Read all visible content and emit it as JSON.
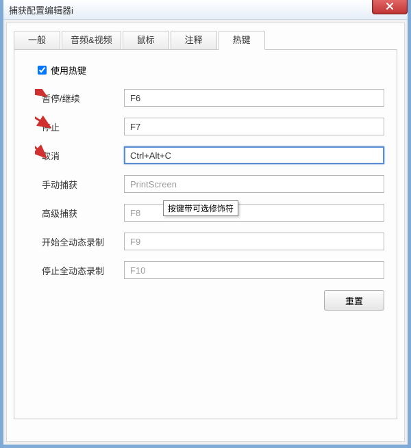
{
  "window": {
    "title": "捕获配置编辑器i"
  },
  "tabs": {
    "items": [
      {
        "label": "一般"
      },
      {
        "label": "音频&视频"
      },
      {
        "label": "鼠标"
      },
      {
        "label": "注释"
      },
      {
        "label": "热键"
      }
    ],
    "active_index": 4
  },
  "hotkey_page": {
    "use_hotkeys_label": "使用热键",
    "use_hotkeys_checked": true,
    "rows": [
      {
        "label": "暂停/继续",
        "value": "F6",
        "disabled": false,
        "selected": false
      },
      {
        "label": "停止",
        "value": "F7",
        "disabled": false,
        "selected": false
      },
      {
        "label": "取消",
        "value": "Ctrl+Alt+C",
        "disabled": false,
        "selected": true
      },
      {
        "label": "手动捕获",
        "value": "PrintScreen",
        "disabled": true,
        "selected": false
      },
      {
        "label": "高级捕获",
        "value": "F8",
        "disabled": true,
        "selected": false
      },
      {
        "label": "开始全动态录制",
        "value": "F9",
        "disabled": true,
        "selected": false
      },
      {
        "label": "停止全动态录制",
        "value": "F10",
        "disabled": true,
        "selected": false
      }
    ],
    "tooltip": "按键带可选修饰符",
    "reset_label": "重置"
  }
}
